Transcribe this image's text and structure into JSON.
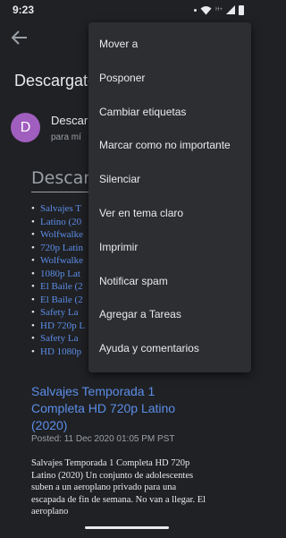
{
  "status_bar": {
    "time": "9:23",
    "network_label": "H+",
    "icons": [
      "notification-dot-icon",
      "wifi-icon",
      "signal-icon",
      "battery-icon"
    ]
  },
  "toolbar": {
    "back_icon": "arrow-left-icon"
  },
  "email": {
    "subject": "Descargate",
    "sender": "Descar",
    "avatar_letter": "D",
    "recipient": "para mí"
  },
  "body": {
    "heading": "Descarg",
    "links": [
      "Salvajes T",
      "Latino (20",
      "Wolfwalke",
      "720p Latin",
      "Wolfwalke",
      "1080p Lat",
      "El Baile (2",
      "El Baile (2",
      "Safety La",
      "HD 720p L",
      "Safety La",
      "HD 1080p"
    ],
    "post_title": "Salvajes Temporada 1 Completa HD 720p Latino (2020)",
    "post_date": "Posted: 11 Dec 2020 01:05 PM PST",
    "post_text": "Salvajes Temporada 1 Completa HD 720p Latino (2020) Un conjunto de adolescentes suben a un aeroplano privado para una escapada de fin de semana. No van a llegar. El aeroplano"
  },
  "menu": {
    "items": [
      "Mover a",
      "Posponer",
      "Cambiar etiquetas",
      "Marcar como no importante",
      "Silenciar",
      "Ver en tema claro",
      "Imprimir",
      "Notificar spam",
      "Agregar a Tareas",
      "Ayuda y comentarios"
    ]
  },
  "colors": {
    "background": "#202124",
    "menu_background": "#2d2e31",
    "text": "#e8eaed",
    "secondary_text": "#9aa0a6",
    "link": "#5b8de8",
    "avatar": "#a05ebf"
  }
}
